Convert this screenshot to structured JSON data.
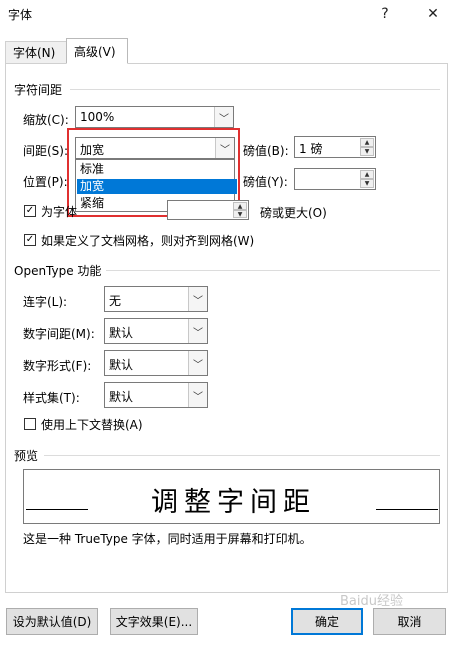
{
  "dialog": {
    "title": "字体",
    "help_label": "?",
    "close_label": "✕"
  },
  "tabs": [
    {
      "label": "字体(N)",
      "key": "N"
    },
    {
      "label": "高级(V)",
      "key": "V"
    }
  ],
  "char_spacing": {
    "heading": "字符间距",
    "scale": {
      "label": "缩放(C):",
      "value": "100%"
    },
    "spacing": {
      "label": "间距(S):",
      "value": "加宽",
      "options": [
        "标准",
        "加宽",
        "紧缩"
      ],
      "selected": "加宽"
    },
    "spacing_by": {
      "label": "磅值(B):",
      "value": "1 磅"
    },
    "position": {
      "label": "位置(P):"
    },
    "position_by": {
      "label": "磅值(Y):",
      "value": ""
    },
    "kerning": {
      "label": "为字体",
      "suffix": "磅或更大(O)",
      "checked": true
    },
    "snap_grid": {
      "label": "如果定义了文档网格，则对齐到网格(W)",
      "checked": true
    }
  },
  "opentype": {
    "heading": "OpenType 功能",
    "ligatures": {
      "label": "连字(L):",
      "value": "无"
    },
    "num_spacing": {
      "label": "数字间距(M):",
      "value": "默认"
    },
    "num_forms": {
      "label": "数字形式(F):",
      "value": "默认"
    },
    "stylistic_sets": {
      "label": "样式集(T):",
      "value": "默认"
    },
    "contextual": {
      "label": "使用上下文替换(A)",
      "checked": false
    }
  },
  "preview": {
    "heading": "预览",
    "sample": "调整字间距",
    "note": "这是一种 TrueType 字体，同时适用于屏幕和打印机。"
  },
  "buttons": {
    "set_default": "设为默认值(D)",
    "text_effects": "文字效果(E)...",
    "ok": "确定",
    "cancel": "取消"
  },
  "watermark": "Baidu经验",
  "icons": {
    "dropdown": "chevron-down-icon",
    "spin_up": "spin-up-icon",
    "spin_down": "spin-down-icon",
    "check": "check-icon"
  },
  "colors": {
    "highlight": "#0078d7",
    "annotation": "#e03030"
  }
}
